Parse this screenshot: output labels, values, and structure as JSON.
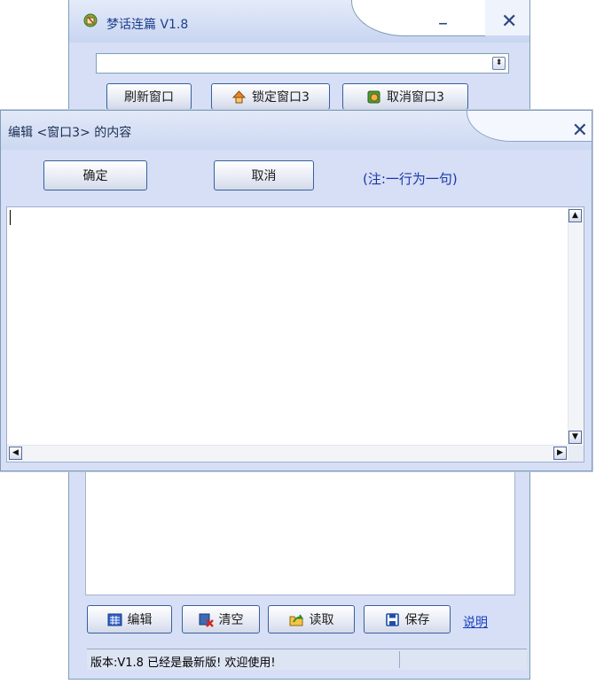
{
  "main_window": {
    "title": "梦话连篇 V1.8",
    "minimize_glyph": "–",
    "close_glyph": "✕",
    "combo": {
      "value": "",
      "arrow_glyph": "⬍"
    },
    "top_buttons": [
      {
        "label": "刷新窗口",
        "icon": ""
      },
      {
        "label": "锁定窗口3",
        "icon": "house-lock-icon"
      },
      {
        "label": "取消窗口3",
        "icon": "settings-gear-icon"
      }
    ],
    "bottom_toolbar": {
      "edit_label": "编辑",
      "clear_label": "清空",
      "read_label": "读取",
      "save_label": "保存",
      "help_link": "说明"
    },
    "status_bar": {
      "text": "版本:V1.8 已经是最新版! 欢迎使用!"
    }
  },
  "edit_dialog": {
    "title": "编辑 <窗口3> 的内容",
    "close_glyph": "✕",
    "ok_label": "确定",
    "cancel_label": "取消",
    "note": "(注:一行为一句)",
    "content": "",
    "scroll_up": "▲",
    "scroll_down": "▼",
    "scroll_left": "◀",
    "scroll_right": "▶"
  },
  "colors": {
    "window_bg": "#d6dff5",
    "border": "#7f9db9",
    "link": "#1a3fc0",
    "note": "#1a37a8"
  }
}
